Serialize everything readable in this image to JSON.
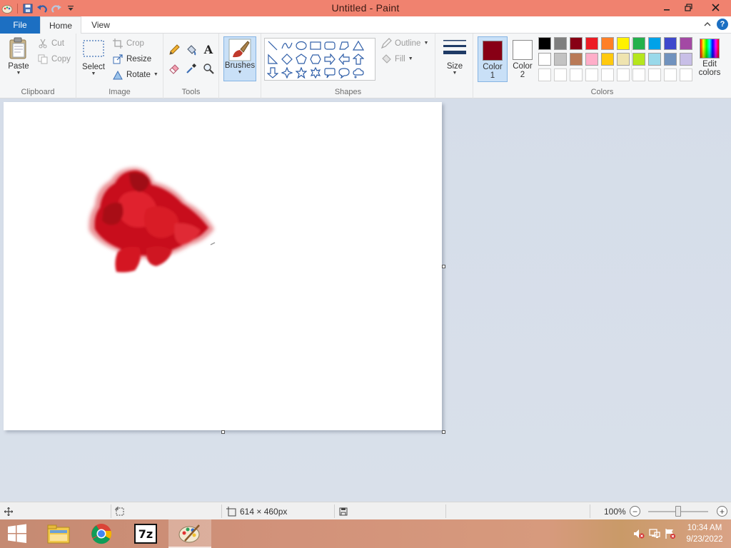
{
  "window": {
    "title": "Untitled - Paint"
  },
  "tabs": {
    "file": "File",
    "home": "Home",
    "view": "View"
  },
  "clipboard": {
    "paste": "Paste",
    "cut": "Cut",
    "copy": "Copy",
    "label": "Clipboard"
  },
  "image": {
    "select": "Select",
    "crop": "Crop",
    "resize": "Resize",
    "rotate": "Rotate",
    "label": "Image"
  },
  "tools": {
    "label": "Tools",
    "items": [
      "pencil-icon",
      "fill-bucket-icon",
      "text-icon",
      "eraser-icon",
      "color-picker-icon",
      "magnifier-icon"
    ]
  },
  "brushes": {
    "label": "Brushes"
  },
  "shapes": {
    "label": "Shapes",
    "outline": "Outline",
    "fill": "Fill",
    "items": [
      "line",
      "curve",
      "oval",
      "rectangle",
      "rounded-rectangle",
      "polygon",
      "triangle",
      "right-triangle",
      "diamond",
      "pentagon",
      "hexagon",
      "right-arrow",
      "left-arrow",
      "up-arrow",
      "down-arrow",
      "four-point-star",
      "five-point-star",
      "six-point-star",
      "rounded-callout",
      "oval-callout",
      "cloud-callout"
    ]
  },
  "size": {
    "label": "Size"
  },
  "colors": {
    "color1_label": "Color 1",
    "color1_line1": "Color",
    "color1_line2": "1",
    "color1_value": "#880015",
    "color2_line1": "Color",
    "color2_line2": "2",
    "color2_value": "#ffffff",
    "edit_line1": "Edit",
    "edit_line2": "colors",
    "label": "Colors",
    "palette_row1": [
      "#000000",
      "#7f7f7f",
      "#880015",
      "#ed1c24",
      "#ff7f27",
      "#fff200",
      "#22b14c",
      "#00a2e8",
      "#3f48cc",
      "#a349a4"
    ],
    "palette_row2": [
      "#ffffff",
      "#c3c3c3",
      "#b97a57",
      "#ffaec9",
      "#ffc90e",
      "#efe4b0",
      "#b5e61d",
      "#99d9ea",
      "#7092be",
      "#c8bfe7"
    ],
    "palette_row3": [
      "#ffffff",
      "#ffffff",
      "#ffffff",
      "#ffffff",
      "#ffffff",
      "#ffffff",
      "#ffffff",
      "#ffffff",
      "#ffffff",
      "#ffffff"
    ]
  },
  "status": {
    "canvas_size": "614 × 460px",
    "zoom": "100%"
  },
  "taskbar": {
    "apps": [
      "start-icon",
      "file-explorer-icon",
      "chrome-icon",
      "7zip-icon",
      "paint-icon"
    ],
    "sevenzip_text": "7z",
    "time": "10:34 AM",
    "date": "9/23/2022"
  }
}
